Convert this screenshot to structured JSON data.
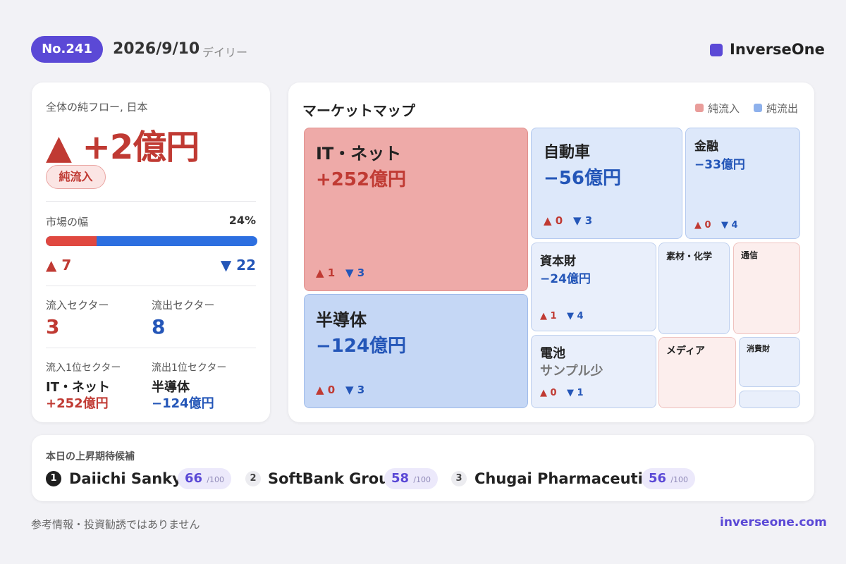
{
  "header": {
    "issue_no": "No.241",
    "date": "2026/9/10",
    "frequency": "デイリー",
    "brand": "InverseOne",
    "brand_color": "#5b49d6"
  },
  "overview": {
    "caption": "全体の純フロー, 日本",
    "net_flow": "▲ +2億円",
    "status": "純流入",
    "breadth_label": "市場の幅",
    "breadth_pct_label": "24%",
    "breadth_up_fraction": 0.24,
    "up_count": "▲ 7",
    "down_count": "▼ 22",
    "inflow_sectors_label": "流入セクター",
    "inflow_sectors": "3",
    "outflow_sectors_label": "流出セクター",
    "outflow_sectors": "8",
    "top_inflow_label": "流入1位セクター",
    "top_inflow_name": "IT・ネット",
    "top_inflow_value": "+252億円",
    "top_outflow_label": "流出1位セクター",
    "top_outflow_name": "半導体",
    "top_outflow_value": "−124億円"
  },
  "market_map": {
    "title": "マーケットマップ",
    "legend_inflow": "純流入",
    "legend_outflow": "純流出",
    "legend_inflow_color": "#e99d9a",
    "legend_outflow_color": "#8eb1ec",
    "tiles": {
      "it": {
        "name": "IT・ネット",
        "value": "+252億円",
        "up": "▲ 1",
        "down": "▼ 3"
      },
      "semi": {
        "name": "半導体",
        "value": "−124億円",
        "up": "▲ 0",
        "down": "▼ 3"
      },
      "auto": {
        "name": "自動車",
        "value": "−56億円",
        "up": "▲ 0",
        "down": "▼ 3"
      },
      "finance": {
        "name": "金融",
        "value": "−33億円",
        "up": "▲ 0",
        "down": "▼ 4"
      },
      "capital": {
        "name": "資本財",
        "value": "−24億円",
        "up": "▲ 1",
        "down": "▼ 4"
      },
      "materials": {
        "name": "素材・化学"
      },
      "telecom": {
        "name": "通信"
      },
      "battery": {
        "name": "電池",
        "value": "サンプル少",
        "up": "▲ 0",
        "down": "▼ 1"
      },
      "media": {
        "name": "メディア"
      },
      "consumer": {
        "name": "消費財"
      }
    }
  },
  "picks": {
    "caption": "本日の上昇期待候補",
    "items": [
      {
        "rank": "1",
        "name": "Daiichi Sankyo",
        "score": "66",
        "max": "/100"
      },
      {
        "rank": "2",
        "name": "SoftBank Group",
        "score": "58",
        "max": "/100"
      },
      {
        "rank": "3",
        "name": "Chugai Pharmaceutical",
        "score": "56",
        "max": "/100"
      }
    ]
  },
  "footer": {
    "disclaimer": "参考情報・投資勧誘ではありません",
    "url": "inverseone.com"
  }
}
